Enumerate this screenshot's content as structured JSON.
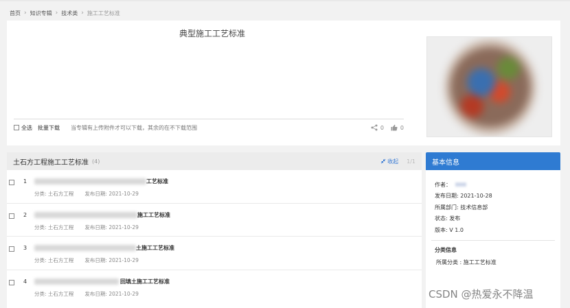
{
  "breadcrumb": {
    "items": [
      "首页",
      "知识专辑",
      "技术类",
      "施工工艺标准"
    ]
  },
  "album": {
    "title": "典型施工工艺标准",
    "select_all": "全选",
    "batch_download": "批量下载",
    "hint": "当专辑有上传附件才可以下载，其余的在不下载范围",
    "share_count": "0",
    "like_count": "0"
  },
  "list": {
    "title": "土石方工程施工工艺标准",
    "count": "(4)",
    "collapse": "收起",
    "pagination": "1/1",
    "items": [
      {
        "num": "1",
        "name": "工艺标准",
        "category": "分类: 土石方工程",
        "date": "发布日期: 2021-10-29"
      },
      {
        "num": "2",
        "name": "施工工艺标准",
        "category": "分类: 土石方工程",
        "date": "发布日期: 2021-10-29"
      },
      {
        "num": "3",
        "name": "土施工工艺标准",
        "category": "分类: 土石方工程",
        "date": "发布日期: 2021-10-29"
      },
      {
        "num": "4",
        "name": "回填土施工工艺标准",
        "category": "分类: 土石方工程",
        "date": "发布日期: 2021-10-29"
      }
    ]
  },
  "sidebar": {
    "title": "基本信息",
    "author_label": "作者：",
    "publish_date": "发布日期:   2021-10-28",
    "department": "所属部门:   技术信息部",
    "status": "状态:   发布",
    "version": "版本:   V 1.0",
    "category_title": "分类信息",
    "category_line": "所属分类 : 施工工艺标准"
  },
  "watermark": "CSDN @热爱永不降温",
  "colors": {
    "accent": "#2f7bd2",
    "link": "#3a7bd5"
  }
}
